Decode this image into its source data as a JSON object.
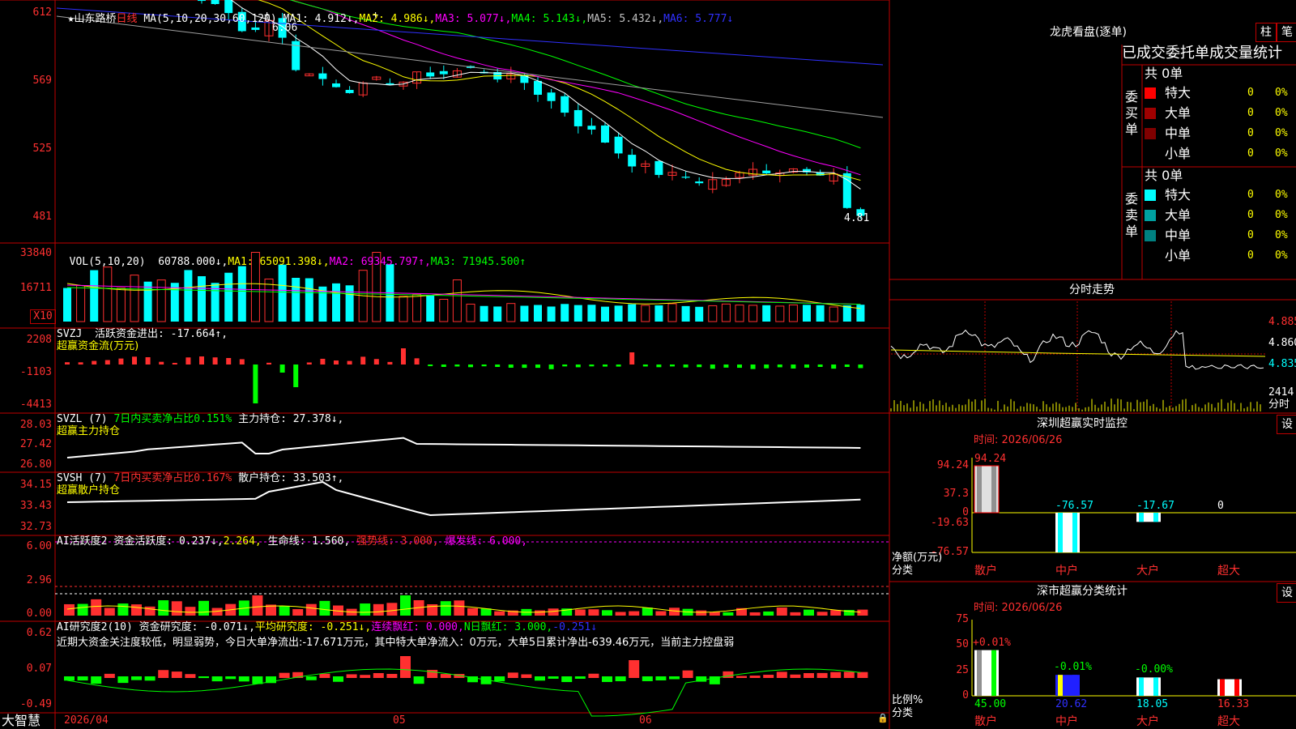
{
  "colors": {
    "up": "#ff3030",
    "down": "#00ffff",
    "grid": "#c00000",
    "ma1": "#ffffff",
    "ma2": "#ffff00",
    "ma3": "#ff00ff",
    "ma4": "#00ff00",
    "ma5": "#a0a0a0",
    "ma6": "#3030ff"
  },
  "header": {
    "star": "★",
    "stock": "山东路桥",
    "period": "日线",
    "ma_def": "MA(5,10,20,30,60,120)",
    "ma1": "MA1: 4.912↓,",
    "ma2": "MA2: 4.986↓,",
    "ma3": "MA3: 5.077↓,",
    "ma4": "MA4: 5.143↓,",
    "ma5": "MA5: 5.432↓,",
    "ma6": "MA6: 5.777↓"
  },
  "price_axis": [
    "612",
    "569",
    "525",
    "481"
  ],
  "price_marks": {
    "high": "6.06",
    "low": "4.81"
  },
  "vol": {
    "title": "VOL(5,10,20)",
    "value": "60788.000↓,",
    "ma1": "MA1: 65091.398↓,",
    "ma2": "MA2: 69345.797↑,",
    "ma3": "MA3: 71945.500↑",
    "axis": [
      "33840",
      "16711"
    ],
    "x10": "X10"
  },
  "svzj": {
    "title": "SVZJ  活跃资金进出: -17.664↑,",
    "sub": "超赢资金流(万元)",
    "axis": [
      "2208",
      "-1103",
      "-4413"
    ]
  },
  "svzl": {
    "title": "SVZL (7) ",
    "ratio": "7日内买卖净占比0.151%",
    "holding": " 主力持仓: 27.378↓,",
    "sub": "超赢主力持仓",
    "axis": [
      "28.03",
      "27.42",
      "26.80"
    ]
  },
  "svsh": {
    "title": "SVSH (7) ",
    "ratio": "7日内买卖净占比0.167%",
    "holding": " 散户持仓: 33.503↑,",
    "sub": "超赢散户持仓",
    "axis": [
      "34.15",
      "33.43",
      "32.73"
    ]
  },
  "ai1": {
    "title": "AI活跃度2 ",
    "a": "资金活跃度: 0.237↓,",
    "b": "2.264,",
    "c": "生命线: 1.560,",
    "d": "强势线: 3.000,",
    "e": "爆发线: 6.000,",
    "axis": [
      "6.00",
      "2.96",
      "0.00"
    ]
  },
  "ai2": {
    "title": "AI研究度2(10) ",
    "a": "资金研究度: -0.071↓,",
    "b": "平均研究度: -0.251↓,",
    "c": "连续飘红: 0.000,",
    "d": "N日飘红: 3.000,",
    "e": "-0.251↓",
    "comment": "近期大资金关注度较低，明显弱势，今日大单净流出:-17.671万元，其中特大单净流入：0万元，大单5日累计净出-639.46万元，当前主力控盘弱",
    "axis": [
      "0.62",
      "0.07",
      "-0.49"
    ]
  },
  "bottom": {
    "brand": "大智慧",
    "date1": "2026/04",
    "date2": "05",
    "date3": "06"
  },
  "lhkp": {
    "title": "龙虎看盘(逐单)",
    "btn1": "柱",
    "btn2": "笔",
    "subtitle": "已成交委托单成交量统计",
    "buy": {
      "side": "委买单",
      "total": "共 0单",
      "rows": [
        {
          "name": "特大",
          "n": "0",
          "pct": "0%"
        },
        {
          "name": "大单",
          "n": "0",
          "pct": "0%"
        },
        {
          "name": "中单",
          "n": "0",
          "pct": "0%"
        },
        {
          "name": "小单",
          "n": "0",
          "pct": "0%"
        }
      ]
    },
    "sell": {
      "side": "委卖单",
      "total": "共 0单",
      "rows": [
        {
          "name": "特大",
          "n": "0",
          "pct": "0%"
        },
        {
          "name": "大单",
          "n": "0",
          "pct": "0%"
        },
        {
          "name": "中单",
          "n": "0",
          "pct": "0%"
        },
        {
          "name": "小单",
          "n": "0",
          "pct": "0%"
        }
      ]
    }
  },
  "fenshi": {
    "title": "分时走势",
    "axis": [
      "4.885",
      "4.860",
      "4.835"
    ],
    "vol_axis": "2414",
    "vol_unit": "分时"
  },
  "sz_monitor": {
    "title": "深圳超赢实时监控",
    "btn": "设",
    "time": "时间: 2026/06/26",
    "axis": [
      "94.24",
      "37.3",
      "0",
      "-19.63",
      "-76.57"
    ],
    "unit": "净额(万元)",
    "cat_label": "分类",
    "bars": [
      {
        "cat": "散户",
        "value": 94.24,
        "label": "94.24"
      },
      {
        "cat": "中户",
        "value": -76.57,
        "label": "-76.57"
      },
      {
        "cat": "大户",
        "value": -17.67,
        "label": "-17.67"
      },
      {
        "cat": "超大",
        "value": 0,
        "label": "0"
      }
    ]
  },
  "sz_class": {
    "title": "深市超赢分类统计",
    "btn": "设",
    "time": "时间: 2026/06/26",
    "axis": [
      "75",
      "50",
      "25",
      "0"
    ],
    "unit": "比例%",
    "cat_label": "分类",
    "bars": [
      {
        "cat": "散户",
        "value": 45.0,
        "label": "45.00",
        "delta": "+0.01%"
      },
      {
        "cat": "中户",
        "value": 20.62,
        "label": "20.62",
        "delta": "-0.01%"
      },
      {
        "cat": "大户",
        "value": 18.05,
        "label": "18.05",
        "delta": "-0.00%"
      },
      {
        "cat": "超大",
        "value": 16.33,
        "label": "16.33",
        "delta": ""
      }
    ]
  }
}
